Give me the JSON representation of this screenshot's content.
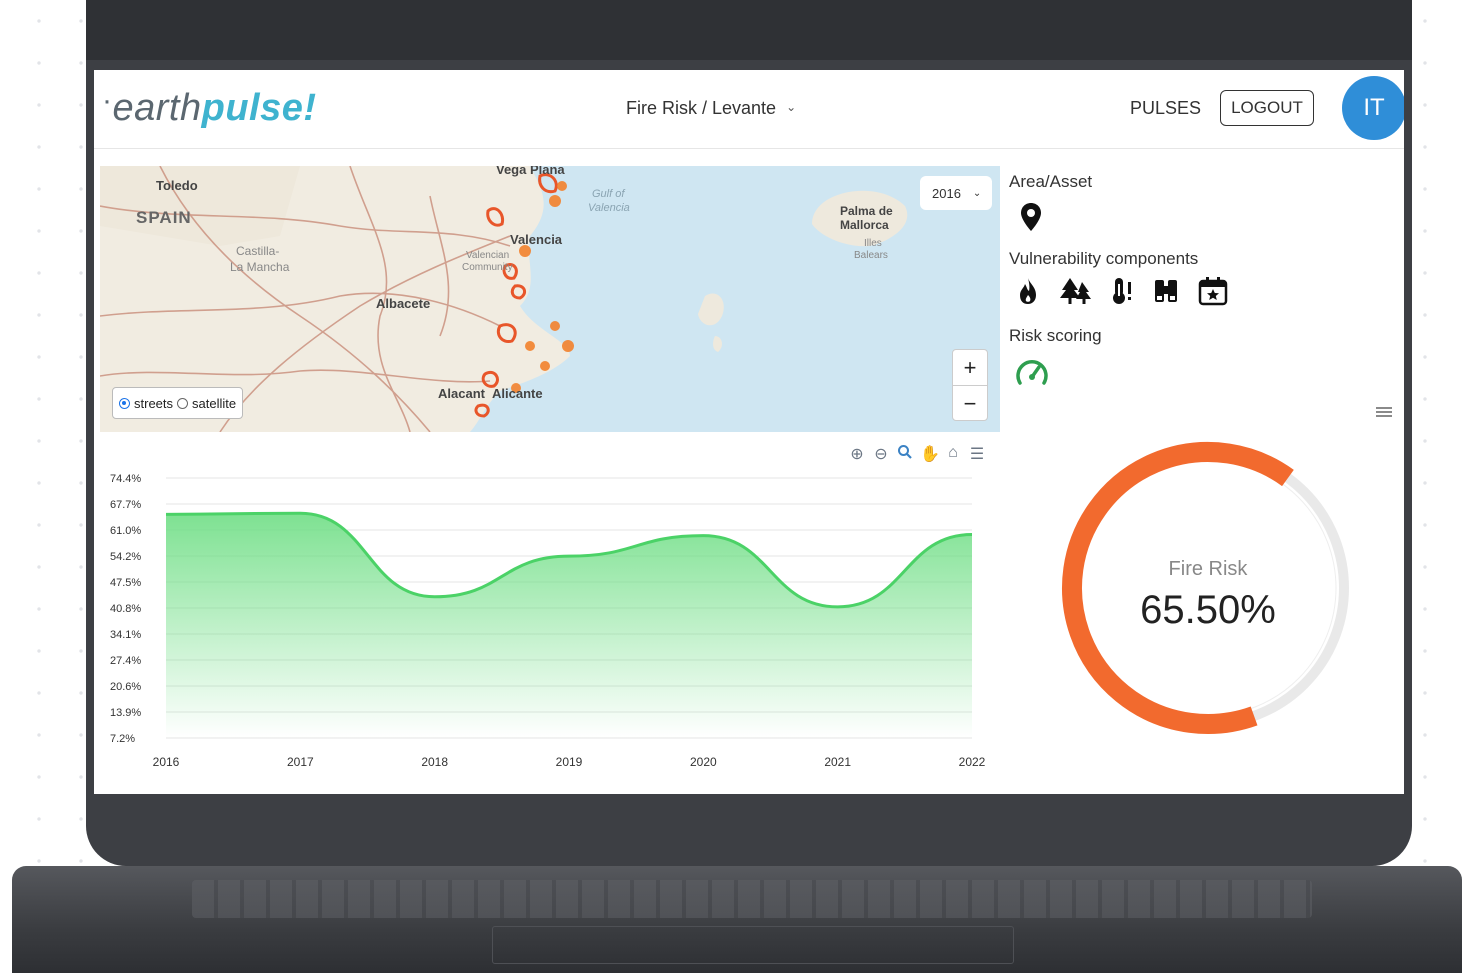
{
  "app": {
    "logo_prefix": "earth",
    "logo_suffix": "pulse!"
  },
  "header": {
    "breadcrumb_section": "Fire Risk /",
    "breadcrumb_region": "Levante",
    "pulses_label": "PULSES",
    "logout_label": "LOGOUT",
    "avatar_initials": "IT"
  },
  "map": {
    "year_selected": "2016",
    "layer_options": [
      "streets",
      "satellite"
    ],
    "layer_selected": "streets",
    "zoom_in": "+",
    "zoom_out": "−",
    "labels": {
      "toledo": "Toledo",
      "spain": "SPAIN",
      "castilla": "Castilla-",
      "la_mancha": "La Mancha",
      "albacete": "Albacete",
      "valencia": "Valencia",
      "valencian": "Valencian",
      "community": "Community",
      "alicante": "Alicante",
      "alacant": "Alacant",
      "gulf": "Gulf of",
      "gulf2": "Valencia",
      "palma": "Palma de",
      "mallorca": "Mallorca",
      "illes": "Illes",
      "balears": "Balears",
      "vega": "Vega Plana"
    }
  },
  "right_panel": {
    "area_asset_label": "Area/Asset",
    "vulnerability_label": "Vulnerability components",
    "risk_scoring_label": "Risk scoring",
    "vulnerability_icons": [
      "fire-icon",
      "trees-icon",
      "thermometer-alert-icon",
      "binoculars-icon",
      "calendar-star-icon"
    ]
  },
  "gauge": {
    "title": "Fire Risk",
    "value_text": "65.50%",
    "fraction": 0.655,
    "color": "#f26a2e"
  },
  "chart_data": {
    "type": "area",
    "x": [
      "2016",
      "2017",
      "2018",
      "2019",
      "2020",
      "2021",
      "2022"
    ],
    "series": [
      {
        "values": [
          65.0,
          65.3,
          43.7,
          54.2,
          59.5,
          41.1,
          59.8
        ]
      }
    ],
    "y_ticks": [
      "74.4%",
      "67.7%",
      "61.0%",
      "54.2%",
      "47.5%",
      "40.8%",
      "34.1%",
      "27.4%",
      "20.6%",
      "13.9%",
      "7.2%"
    ],
    "ylim": [
      7.2,
      74.4
    ],
    "color": "#4bd267",
    "grid": true
  }
}
